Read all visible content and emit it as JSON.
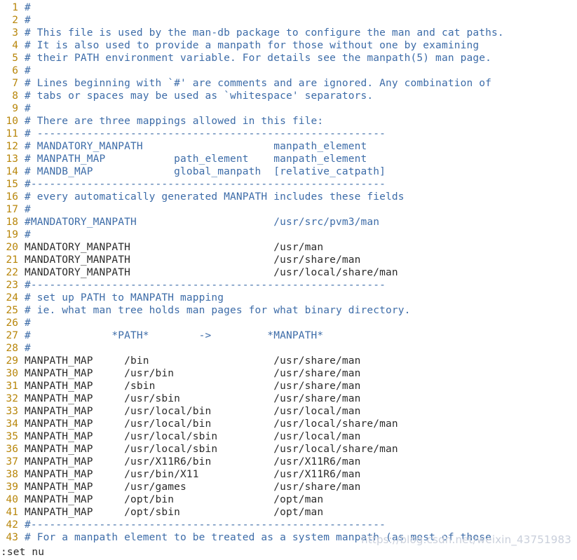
{
  "editor": {
    "name": "vim",
    "mode_command": ":set nu",
    "colors": {
      "background": "#ffffff",
      "line_number": "#b8860b",
      "comment": "#3d6ca8",
      "normal_text": "#2b2b2b",
      "watermark": "#c9cfdb"
    }
  },
  "status_line": {
    "text": ":set nu"
  },
  "watermark": {
    "text": "https://blog.csdn.net/weixin_43751983"
  },
  "buffer": {
    "first_visible_line": 1,
    "last_visible_line": 43,
    "lines": [
      {
        "n": "1",
        "comment": true,
        "text": "#"
      },
      {
        "n": "2",
        "comment": true,
        "text": "#"
      },
      {
        "n": "3",
        "comment": true,
        "text": "# This file is used by the man-db package to configure the man and cat paths."
      },
      {
        "n": "4",
        "comment": true,
        "text": "# It is also used to provide a manpath for those without one by examining"
      },
      {
        "n": "5",
        "comment": true,
        "text": "# their PATH environment variable. For details see the manpath(5) man page."
      },
      {
        "n": "6",
        "comment": true,
        "text": "#"
      },
      {
        "n": "7",
        "comment": true,
        "text": "# Lines beginning with `#' are comments and are ignored. Any combination of"
      },
      {
        "n": "8",
        "comment": true,
        "text": "# tabs or spaces may be used as `whitespace' separators."
      },
      {
        "n": "9",
        "comment": true,
        "text": "#"
      },
      {
        "n": "10",
        "comment": true,
        "text": "# There are three mappings allowed in this file:"
      },
      {
        "n": "11",
        "comment": true,
        "text": "# --------------------------------------------------------"
      },
      {
        "n": "12",
        "comment": true,
        "text": "# MANDATORY_MANPATH                     manpath_element"
      },
      {
        "n": "13",
        "comment": true,
        "text": "# MANPATH_MAP           path_element    manpath_element"
      },
      {
        "n": "14",
        "comment": true,
        "text": "# MANDB_MAP             global_manpath  [relative_catpath]"
      },
      {
        "n": "15",
        "comment": true,
        "text": "#---------------------------------------------------------"
      },
      {
        "n": "16",
        "comment": true,
        "text": "# every automatically generated MANPATH includes these fields"
      },
      {
        "n": "17",
        "comment": true,
        "text": "#"
      },
      {
        "n": "18",
        "comment": true,
        "text": "#MANDATORY_MANPATH                      /usr/src/pvm3/man"
      },
      {
        "n": "19",
        "comment": true,
        "text": "#"
      },
      {
        "n": "20",
        "comment": false,
        "text": "MANDATORY_MANPATH                       /usr/man"
      },
      {
        "n": "21",
        "comment": false,
        "text": "MANDATORY_MANPATH                       /usr/share/man"
      },
      {
        "n": "22",
        "comment": false,
        "text": "MANDATORY_MANPATH                       /usr/local/share/man"
      },
      {
        "n": "23",
        "comment": true,
        "text": "#---------------------------------------------------------"
      },
      {
        "n": "24",
        "comment": true,
        "text": "# set up PATH to MANPATH mapping"
      },
      {
        "n": "25",
        "comment": true,
        "text": "# ie. what man tree holds man pages for what binary directory."
      },
      {
        "n": "26",
        "comment": true,
        "text": "#"
      },
      {
        "n": "27",
        "comment": true,
        "text": "#             *PATH*        ->         *MANPATH*"
      },
      {
        "n": "28",
        "comment": true,
        "text": "#"
      },
      {
        "n": "29",
        "comment": false,
        "text": "MANPATH_MAP     /bin                    /usr/share/man"
      },
      {
        "n": "30",
        "comment": false,
        "text": "MANPATH_MAP     /usr/bin                /usr/share/man"
      },
      {
        "n": "31",
        "comment": false,
        "text": "MANPATH_MAP     /sbin                   /usr/share/man"
      },
      {
        "n": "32",
        "comment": false,
        "text": "MANPATH_MAP     /usr/sbin               /usr/share/man"
      },
      {
        "n": "33",
        "comment": false,
        "text": "MANPATH_MAP     /usr/local/bin          /usr/local/man"
      },
      {
        "n": "34",
        "comment": false,
        "text": "MANPATH_MAP     /usr/local/bin          /usr/local/share/man"
      },
      {
        "n": "35",
        "comment": false,
        "text": "MANPATH_MAP     /usr/local/sbin         /usr/local/man"
      },
      {
        "n": "36",
        "comment": false,
        "text": "MANPATH_MAP     /usr/local/sbin         /usr/local/share/man"
      },
      {
        "n": "37",
        "comment": false,
        "text": "MANPATH_MAP     /usr/X11R6/bin          /usr/X11R6/man"
      },
      {
        "n": "38",
        "comment": false,
        "text": "MANPATH_MAP     /usr/bin/X11            /usr/X11R6/man"
      },
      {
        "n": "39",
        "comment": false,
        "text": "MANPATH_MAP     /usr/games              /usr/share/man"
      },
      {
        "n": "40",
        "comment": false,
        "text": "MANPATH_MAP     /opt/bin                /opt/man"
      },
      {
        "n": "41",
        "comment": false,
        "text": "MANPATH_MAP     /opt/sbin               /opt/man"
      },
      {
        "n": "42",
        "comment": true,
        "text": "#---------------------------------------------------------"
      },
      {
        "n": "43",
        "comment": true,
        "text": "# For a manpath element to be treated as a system manpath (as most of those"
      }
    ]
  }
}
